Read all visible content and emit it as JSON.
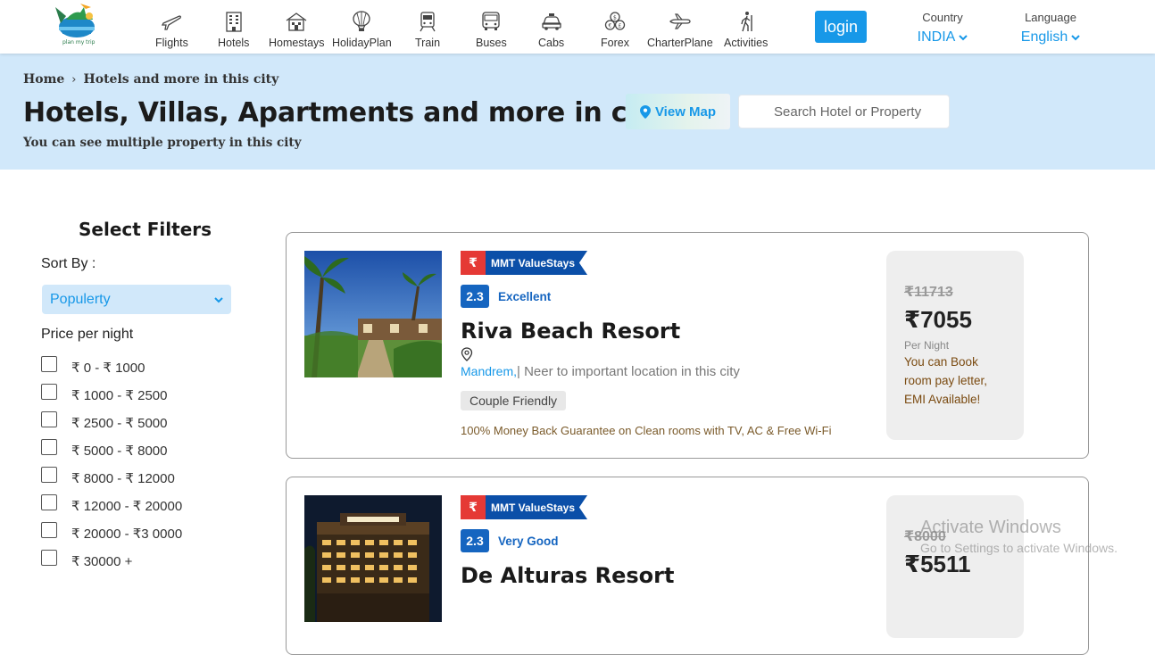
{
  "nav": {
    "logo_text": "plan my trip",
    "items": [
      {
        "label": "Flights",
        "icon": "plane-icon"
      },
      {
        "label": "Hotels",
        "icon": "building-icon"
      },
      {
        "label": "Homestays",
        "icon": "house-icon"
      },
      {
        "label": "HolidayPlan",
        "icon": "balloon-icon"
      },
      {
        "label": "Train",
        "icon": "train-icon"
      },
      {
        "label": "Buses",
        "icon": "bus-icon"
      },
      {
        "label": "Cabs",
        "icon": "car-icon"
      },
      {
        "label": "Forex",
        "icon": "coins-icon"
      },
      {
        "label": "CharterPlane",
        "icon": "charter-plane-icon"
      },
      {
        "label": "Activities",
        "icon": "hiker-icon"
      }
    ],
    "login_label": "login",
    "country": {
      "caption": "Country",
      "value": "INDIA"
    },
    "language": {
      "caption": "Language",
      "value": "English"
    }
  },
  "banner": {
    "breadcrumb": [
      "Home",
      "Hotels and more in this city"
    ],
    "breadcrumb_sep": "›",
    "title": "Hotels, Villas, Apartments and more in city",
    "subtitle": "You can see multiple property in this city",
    "map_label": "View Map",
    "search_placeholder": "Search Hotel or Property"
  },
  "filters": {
    "title": "Select Filters",
    "sort_label": "Sort By :",
    "sort_value": "Populerty",
    "price_label": "Price per night",
    "price_ranges": [
      "₹ 0 - ₹ 1000",
      "₹ 1000 - ₹ 2500",
      "₹ 2500 - ₹ 5000",
      "₹ 5000 - ₹ 8000",
      "₹ 8000 - ₹ 12000",
      "₹ 12000 - ₹ 20000",
      "₹ 20000 - ₹3 0000",
      "₹ 30000 +"
    ]
  },
  "hotels": [
    {
      "badge_symbol": "₹",
      "badge": "MMT ValueStays",
      "rating": "2.3",
      "rating_word": "Excellent",
      "name": "Riva Beach Resort",
      "location": "Mandrem,",
      "location_rest": "| Neer to important location in this city",
      "tag": "Couple Friendly",
      "guarantee": "100% Money Back Guarantee on Clean rooms with TV, AC & Free Wi-Fi",
      "old_price": "₹11713",
      "price": "₹7055",
      "per_night": "Per Night",
      "emi": "You can Book room pay letter, EMI Available!"
    },
    {
      "badge_symbol": "₹",
      "badge": "MMT ValueStays",
      "rating": "2.3",
      "rating_word": "Very Good",
      "name": "De Alturas Resort",
      "old_price": "₹8000",
      "price": "₹5511"
    }
  ],
  "watermark": {
    "line1": "Activate Windows",
    "line2": "Go to Settings to activate Windows."
  },
  "colors": {
    "accent": "#1798e8",
    "banner_bg": "#d1e8fa",
    "rating_blue": "#1565c0",
    "mmt_red": "#e53935",
    "mmt_blue": "#0b4fa8"
  }
}
